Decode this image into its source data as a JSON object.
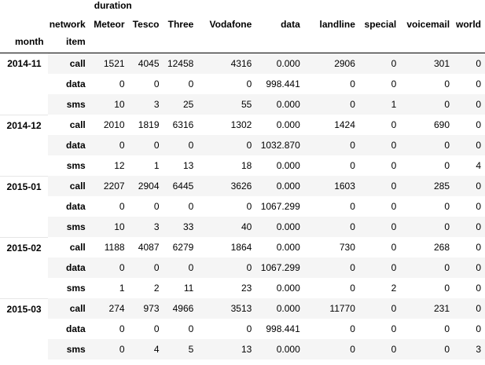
{
  "table": {
    "top_header": "duration",
    "columns_axis_label": "network",
    "rows_axis_label": "item",
    "month_label": "month",
    "columns": [
      "Meteor",
      "Tesco",
      "Three",
      "Vodafone",
      "data",
      "landline",
      "special",
      "voicemail",
      "world"
    ],
    "groups": [
      {
        "month": "2014-11",
        "rows": [
          {
            "item": "call",
            "values": [
              "1521",
              "4045",
              "12458",
              "4316",
              "0.000",
              "2906",
              "0",
              "301",
              "0"
            ]
          },
          {
            "item": "data",
            "values": [
              "0",
              "0",
              "0",
              "0",
              "998.441",
              "0",
              "0",
              "0",
              "0"
            ]
          },
          {
            "item": "sms",
            "values": [
              "10",
              "3",
              "25",
              "55",
              "0.000",
              "0",
              "1",
              "0",
              "0"
            ]
          }
        ]
      },
      {
        "month": "2014-12",
        "rows": [
          {
            "item": "call",
            "values": [
              "2010",
              "1819",
              "6316",
              "1302",
              "0.000",
              "1424",
              "0",
              "690",
              "0"
            ]
          },
          {
            "item": "data",
            "values": [
              "0",
              "0",
              "0",
              "0",
              "1032.870",
              "0",
              "0",
              "0",
              "0"
            ]
          },
          {
            "item": "sms",
            "values": [
              "12",
              "1",
              "13",
              "18",
              "0.000",
              "0",
              "0",
              "0",
              "4"
            ]
          }
        ]
      },
      {
        "month": "2015-01",
        "rows": [
          {
            "item": "call",
            "values": [
              "2207",
              "2904",
              "6445",
              "3626",
              "0.000",
              "1603",
              "0",
              "285",
              "0"
            ]
          },
          {
            "item": "data",
            "values": [
              "0",
              "0",
              "0",
              "0",
              "1067.299",
              "0",
              "0",
              "0",
              "0"
            ]
          },
          {
            "item": "sms",
            "values": [
              "10",
              "3",
              "33",
              "40",
              "0.000",
              "0",
              "0",
              "0",
              "0"
            ]
          }
        ]
      },
      {
        "month": "2015-02",
        "rows": [
          {
            "item": "call",
            "values": [
              "1188",
              "4087",
              "6279",
              "1864",
              "0.000",
              "730",
              "0",
              "268",
              "0"
            ]
          },
          {
            "item": "data",
            "values": [
              "0",
              "0",
              "0",
              "0",
              "1067.299",
              "0",
              "0",
              "0",
              "0"
            ]
          },
          {
            "item": "sms",
            "values": [
              "1",
              "2",
              "11",
              "23",
              "0.000",
              "0",
              "2",
              "0",
              "0"
            ]
          }
        ]
      },
      {
        "month": "2015-03",
        "rows": [
          {
            "item": "call",
            "values": [
              "274",
              "973",
              "4966",
              "3513",
              "0.000",
              "11770",
              "0",
              "231",
              "0"
            ]
          },
          {
            "item": "data",
            "values": [
              "0",
              "0",
              "0",
              "0",
              "998.441",
              "0",
              "0",
              "0",
              "0"
            ]
          },
          {
            "item": "sms",
            "values": [
              "0",
              "4",
              "5",
              "13",
              "0.000",
              "0",
              "0",
              "0",
              "3"
            ]
          }
        ]
      }
    ]
  }
}
